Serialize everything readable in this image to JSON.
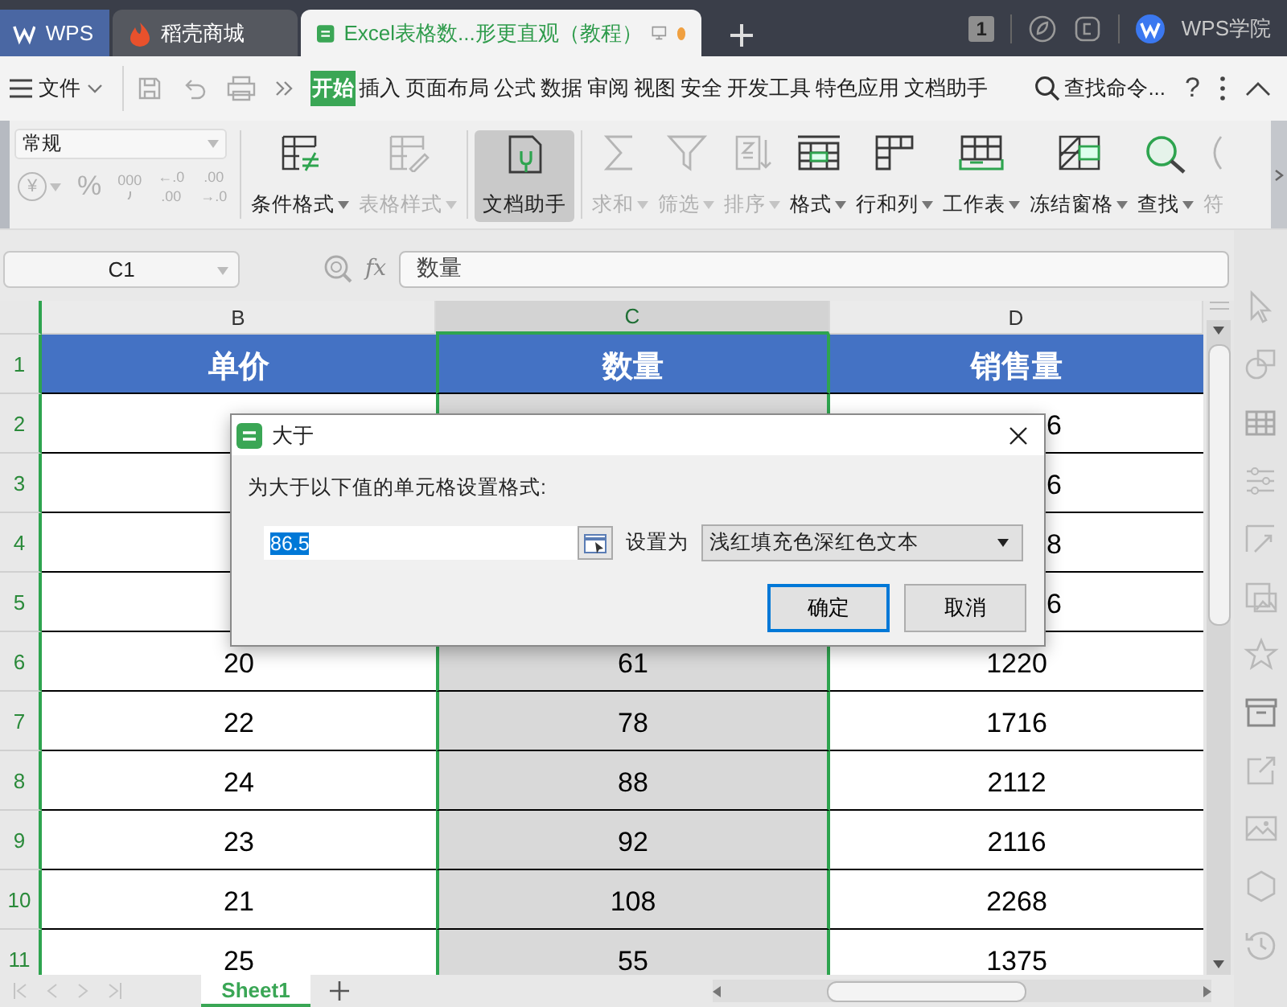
{
  "tabs": [
    {
      "kind": "home",
      "label": "WPS",
      "selected": false
    },
    {
      "kind": "store",
      "label": "稻壳商城",
      "selected": false
    },
    {
      "kind": "doc",
      "label": "Excel表格数...形更直观（教程）",
      "selected": true,
      "unsaved": true
    }
  ],
  "top_right": {
    "badge": "1",
    "account": "WPS学院"
  },
  "menu": {
    "file": "文件",
    "items": [
      {
        "label": "开始",
        "selected": true
      },
      {
        "label": "插入",
        "selected": false
      },
      {
        "label": "页面布局",
        "selected": false
      },
      {
        "label": "公式",
        "selected": false
      },
      {
        "label": "数据",
        "selected": false
      },
      {
        "label": "审阅",
        "selected": false
      },
      {
        "label": "视图",
        "selected": false
      },
      {
        "label": "安全",
        "selected": false
      },
      {
        "label": "开发工具",
        "selected": false
      },
      {
        "label": "特色应用",
        "selected": false
      },
      {
        "label": "文档助手",
        "selected": false
      }
    ],
    "search": "查找命令...",
    "help": "?"
  },
  "ribbon": {
    "number_format": "常规",
    "number_buttons": [
      {
        "kind": "currency",
        "label": "¥"
      },
      {
        "kind": "plain",
        "label": "%"
      },
      {
        "kind": "thousands",
        "label": "000"
      },
      {
        "kind": "decimal",
        "label": "←.0",
        "label2": ".00"
      },
      {
        "kind": "decimal",
        "label": ".00",
        "label2": "→.0"
      }
    ],
    "groups": [
      {
        "tools": [
          {
            "kind": "conditional",
            "label": "条件格式",
            "disabled": false,
            "pressed": false,
            "dropdown": true
          },
          {
            "kind": "table_style",
            "label": "表格样式",
            "disabled": true,
            "pressed": false,
            "dropdown": true
          }
        ]
      },
      {
        "tools": [
          {
            "kind": "assistant",
            "label": "文档助手",
            "disabled": false,
            "pressed": true,
            "dropdown": false
          }
        ]
      },
      {
        "tools": [
          {
            "kind": "sum",
            "label": "求和",
            "disabled": true,
            "pressed": false,
            "dropdown": true
          },
          {
            "kind": "filter",
            "label": "筛选",
            "disabled": true,
            "pressed": false,
            "dropdown": true
          },
          {
            "kind": "sort",
            "label": "排序",
            "disabled": true,
            "pressed": false,
            "dropdown": true
          },
          {
            "kind": "format",
            "label": "格式",
            "disabled": false,
            "pressed": false,
            "dropdown": true
          },
          {
            "kind": "rowcol",
            "label": "行和列",
            "disabled": false,
            "pressed": false,
            "dropdown": true
          },
          {
            "kind": "worksheet",
            "label": "工作表",
            "disabled": false,
            "pressed": false,
            "dropdown": true
          },
          {
            "kind": "freeze",
            "label": "冻结窗格",
            "disabled": false,
            "pressed": false,
            "dropdown": true
          },
          {
            "kind": "find",
            "label": "查找",
            "disabled": false,
            "pressed": false,
            "dropdown": true
          },
          {
            "kind": "symbol",
            "label": "符",
            "disabled": true,
            "pressed": false,
            "dropdown": false
          }
        ]
      }
    ]
  },
  "formula_bar": {
    "cell": "C1",
    "fx": "fx",
    "value": "数量"
  },
  "sheet": {
    "columns": [
      {
        "label": "B",
        "selected": false
      },
      {
        "label": "C",
        "selected": true
      },
      {
        "label": "D",
        "selected": false
      }
    ],
    "rows": [
      {
        "number": "1",
        "kind": "header",
        "cells": [
          "单价",
          "数量",
          "销售量"
        ]
      },
      {
        "number": "2",
        "kind": "covered",
        "tail": "6"
      },
      {
        "number": "3",
        "kind": "covered",
        "tail": "6"
      },
      {
        "number": "4",
        "kind": "covered",
        "tail": "8"
      },
      {
        "number": "5",
        "kind": "covered",
        "tail": "6"
      },
      {
        "number": "6",
        "kind": "data",
        "cells": [
          "20",
          "61",
          "1220"
        ]
      },
      {
        "number": "7",
        "kind": "data",
        "cells": [
          "22",
          "78",
          "1716"
        ]
      },
      {
        "number": "8",
        "kind": "data",
        "cells": [
          "24",
          "88",
          "2112"
        ]
      },
      {
        "number": "9",
        "kind": "data",
        "cells": [
          "23",
          "92",
          "2116"
        ]
      },
      {
        "number": "10",
        "kind": "data",
        "cells": [
          "21",
          "108",
          "2268"
        ]
      },
      {
        "number": "11",
        "kind": "data",
        "cells": [
          "25",
          "55",
          "1375"
        ]
      }
    ]
  },
  "sheet_tabs": [
    {
      "label": "Sheet1",
      "selected": true
    }
  ],
  "dialog": {
    "title": "大于",
    "prompt": "为大于以下值的单元格设置格式:",
    "value": "86.5",
    "value_selected": true,
    "format_label": "设置为",
    "format": "浅红填充色深红色文本",
    "buttons": [
      {
        "label": "确定",
        "default": true
      },
      {
        "label": "取消",
        "default": false
      }
    ]
  }
}
